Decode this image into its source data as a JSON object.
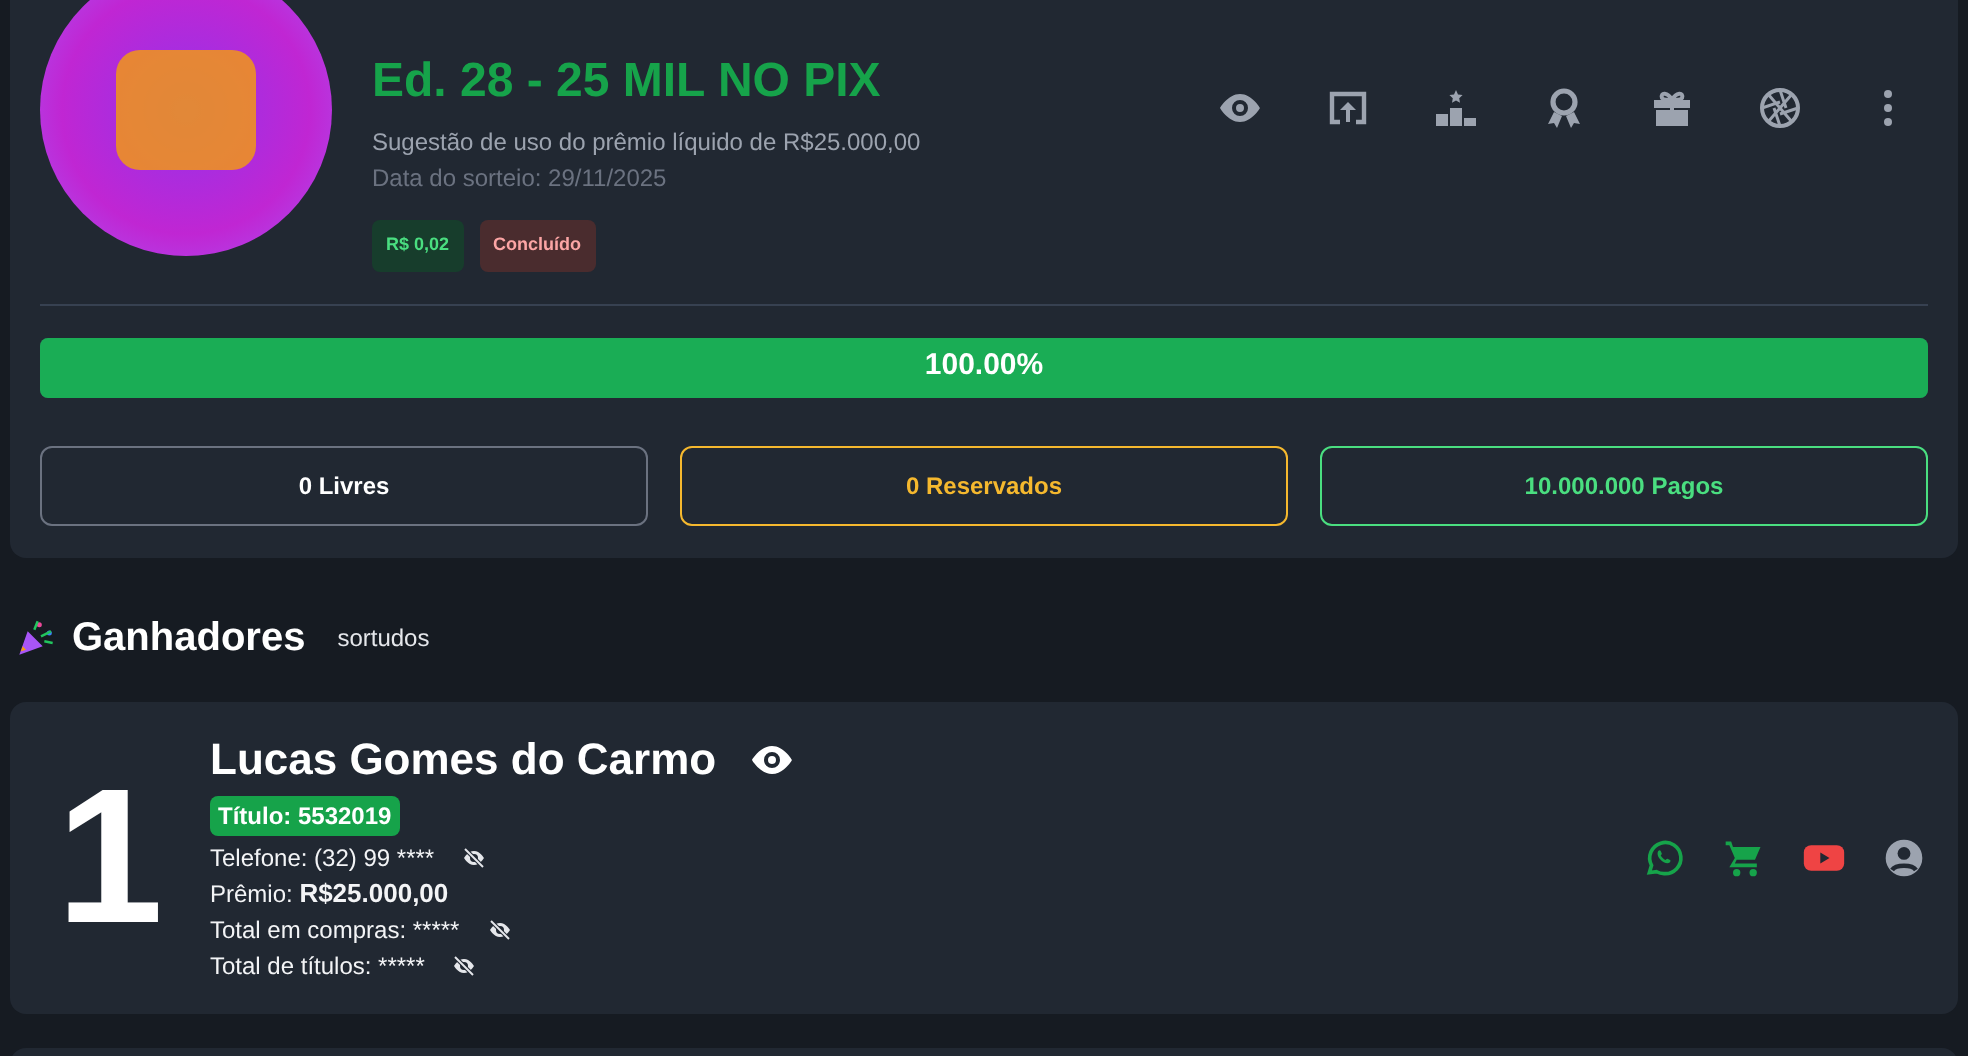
{
  "raffle": {
    "title": "Ed. 28 - 25 MIL NO PIX",
    "subtitle": "Sugestão de uso do prêmio líquido de R$25.000,00",
    "draw_date": "Data do sorteio: 29/11/2025",
    "badges": [
      {
        "label": "R$ 0,02",
        "kind": "price"
      },
      {
        "label": "Concluído",
        "kind": "status"
      }
    ],
    "progress": {
      "level": 1,
      "label": "100.00%"
    },
    "stats": [
      {
        "label": "0 Livres",
        "kind": "free"
      },
      {
        "label": "0 Reservados",
        "kind": "reserved"
      },
      {
        "label": "10.000.000 Pagos",
        "kind": "paid"
      }
    ]
  },
  "winners": {
    "title": "Ganhadores",
    "subtitle": "sortudos",
    "items": [
      {
        "rank": "1",
        "name": "Lucas Gomes do Carmo",
        "ticket": "Título: 5532019",
        "details": [
          {
            "label": "Telefone:",
            "value": "(32) 99 ****",
            "emphasis": false,
            "masked": true
          },
          {
            "label": "Prêmio:",
            "value": "R$25.000,00",
            "emphasis": true,
            "masked": false
          },
          {
            "label": "Total em compras:",
            "value": "*****",
            "emphasis": false,
            "masked": true
          },
          {
            "label": "Total de títulos:",
            "value": "*****",
            "emphasis": false,
            "masked": true
          }
        ]
      }
    ]
  }
}
